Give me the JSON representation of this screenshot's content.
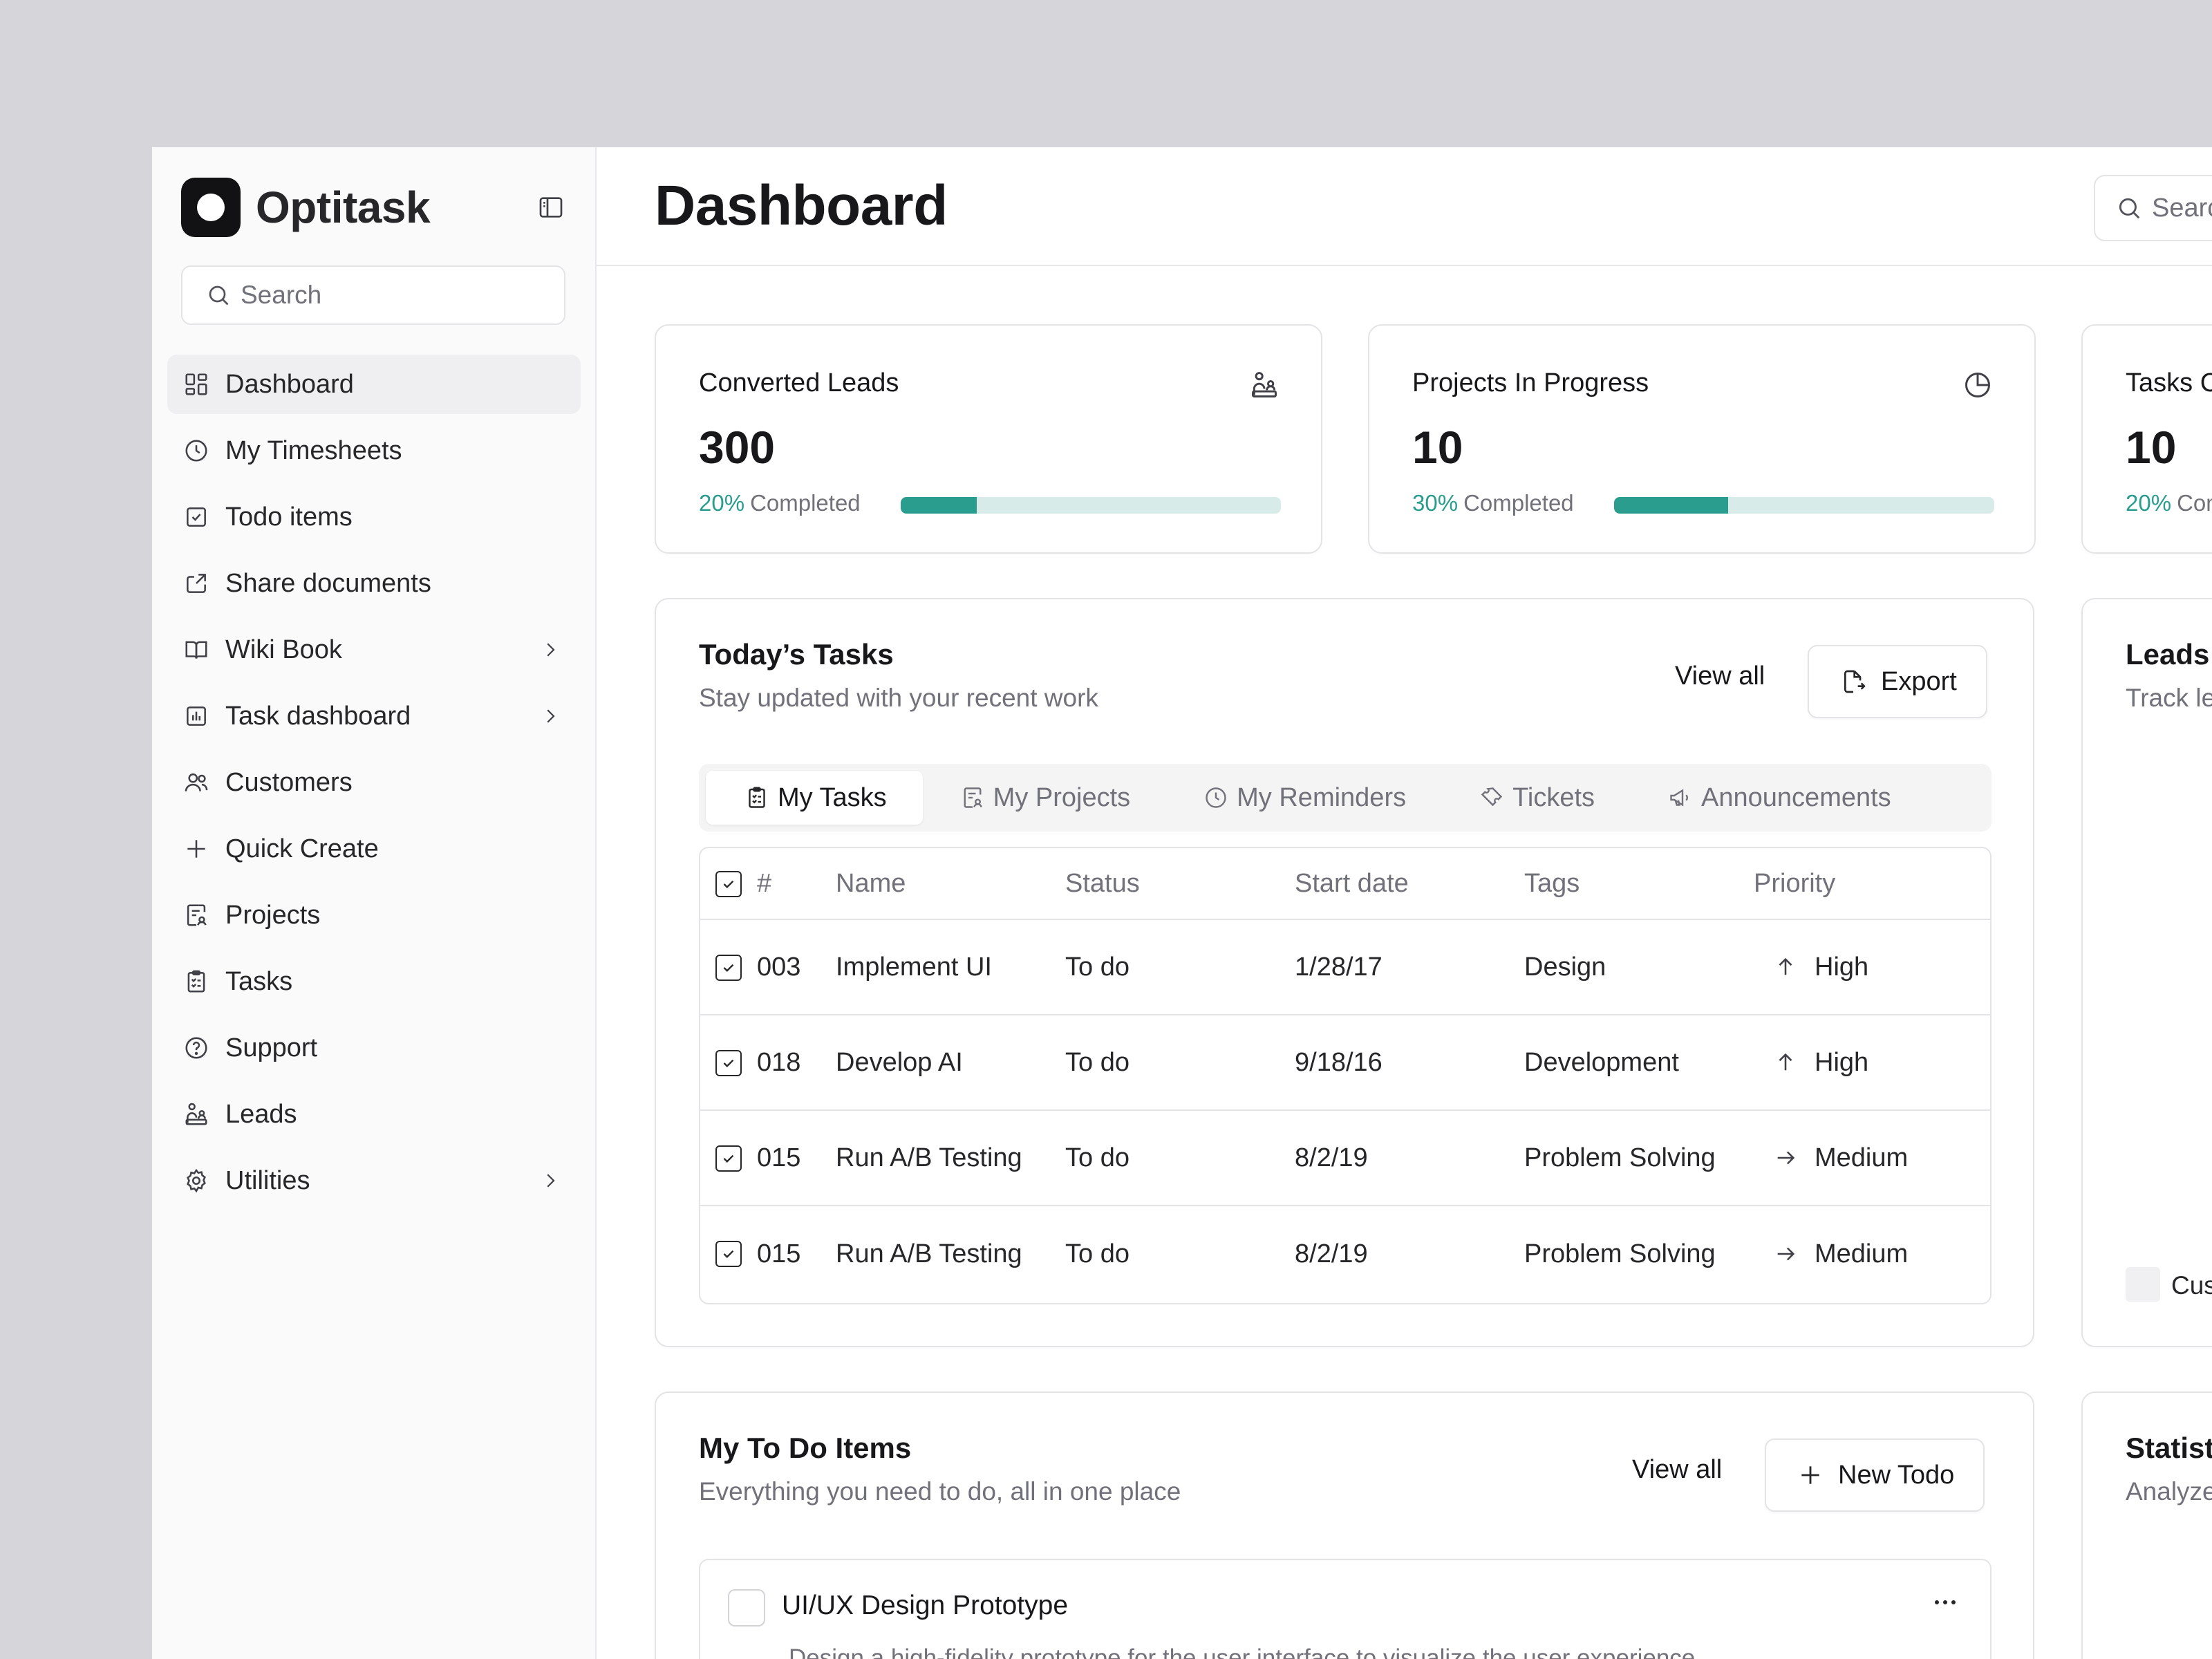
{
  "sidebar": {
    "brand": "Optitask",
    "search_placeholder": "Search",
    "items": [
      {
        "label": "Dashboard"
      },
      {
        "label": "My Timesheets"
      },
      {
        "label": "Todo items"
      },
      {
        "label": "Share documents"
      },
      {
        "label": "Wiki Book"
      },
      {
        "label": "Task dashboard"
      },
      {
        "label": "Customers"
      },
      {
        "label": "Quick Create"
      },
      {
        "label": "Projects"
      },
      {
        "label": "Tasks"
      },
      {
        "label": "Support"
      },
      {
        "label": "Leads"
      },
      {
        "label": "Utilities"
      }
    ]
  },
  "header": {
    "title": "Dashboard",
    "search_placeholder": "Search"
  },
  "stats": [
    {
      "title": "Converted Leads",
      "value": "300",
      "percent": "20%",
      "percent_value": 0.2,
      "suffix": "Completed",
      "icon": "leads-icon"
    },
    {
      "title": "Projects In Progress",
      "value": "10",
      "percent": "30%",
      "percent_value": 0.3,
      "suffix": "Completed",
      "icon": "pie-chart-icon"
    },
    {
      "title": "Tasks Completed",
      "value": "10",
      "percent": "20%",
      "suffix": "Completed"
    }
  ],
  "tasks_card": {
    "title": "Today’s Tasks",
    "subtitle": "Stay updated with your recent work",
    "view_all": "View all",
    "export": "Export",
    "tabs": [
      {
        "label": "My Tasks",
        "icon": "clipboard-list-icon"
      },
      {
        "label": "My Projects",
        "icon": "project-file-icon"
      },
      {
        "label": "My Reminders",
        "icon": "clock-icon"
      },
      {
        "label": "Tickets",
        "icon": "ticket-icon"
      },
      {
        "label": "Announcements",
        "icon": "megaphone-icon"
      }
    ],
    "columns": [
      "#",
      "Name",
      "Status",
      "Start date",
      "Tags",
      "Priority"
    ],
    "rows": [
      {
        "id": "003",
        "name": "Implement UI",
        "status": "To do",
        "start": "1/28/17",
        "tags": "Design",
        "priority": "High"
      },
      {
        "id": "018",
        "name": "Develop AI",
        "status": "To do",
        "start": "9/18/16",
        "tags": "Development",
        "priority": "High"
      },
      {
        "id": "015",
        "name": "Run A/B Testing",
        "status": "To do",
        "start": "8/2/19",
        "tags": "Problem Solving",
        "priority": "Medium"
      },
      {
        "id": "015",
        "name": "Run A/B Testing",
        "status": "To do",
        "start": "8/2/19",
        "tags": "Problem Solving",
        "priority": "Medium"
      }
    ]
  },
  "leads_card": {
    "title": "Leads",
    "subtitle": "Track leads",
    "legend_label": "Customers"
  },
  "todo_card": {
    "title": "My To Do Items",
    "subtitle": "Everything you need to do, all in one place",
    "view_all": "View all",
    "new_todo": "New Todo",
    "items": [
      {
        "title": "UI/UX Design Prototype",
        "description": "Design a high-fidelity prototype for the user interface to visualize the user experience"
      }
    ]
  },
  "statistics_card": {
    "title": "Statistics",
    "subtitle": "Analyze"
  },
  "colors": {
    "accent": "#2a9d8f",
    "accent_track": "#d7ece8"
  }
}
